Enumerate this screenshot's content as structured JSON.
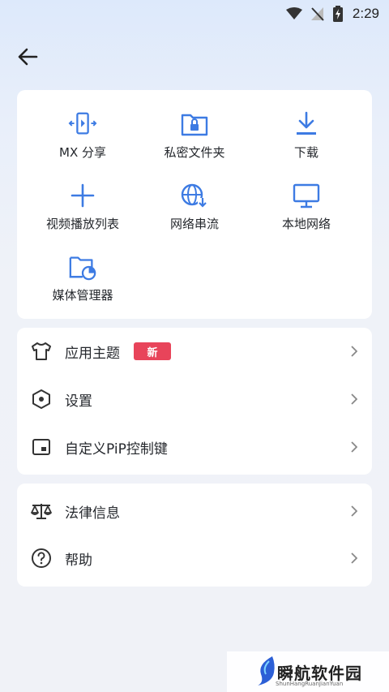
{
  "status_bar": {
    "time": "2:29"
  },
  "grid": [
    {
      "label": "MX 分享",
      "icon": "mx-share-icon"
    },
    {
      "label": "私密文件夹",
      "icon": "private-folder-icon"
    },
    {
      "label": "下载",
      "icon": "download-icon"
    },
    {
      "label": "视频播放列表",
      "icon": "plus-icon"
    },
    {
      "label": "网络串流",
      "icon": "network-stream-icon"
    },
    {
      "label": "本地网络",
      "icon": "monitor-icon"
    },
    {
      "label": "媒体管理器",
      "icon": "media-manager-icon"
    }
  ],
  "menu1": [
    {
      "label": "应用主题",
      "badge": "新",
      "icon": "tshirt-icon"
    },
    {
      "label": "设置",
      "icon": "settings-hex-icon"
    },
    {
      "label": "自定义PiP控制键",
      "icon": "pip-icon"
    }
  ],
  "menu2": [
    {
      "label": "法律信息",
      "icon": "scale-icon"
    },
    {
      "label": "帮助",
      "icon": "help-icon"
    }
  ],
  "watermark": {
    "title": "瞬航软件园",
    "sub": "ShunHangRuanJianYuan"
  },
  "colors": {
    "accent": "#3d7be3",
    "badge": "#e8445a"
  }
}
